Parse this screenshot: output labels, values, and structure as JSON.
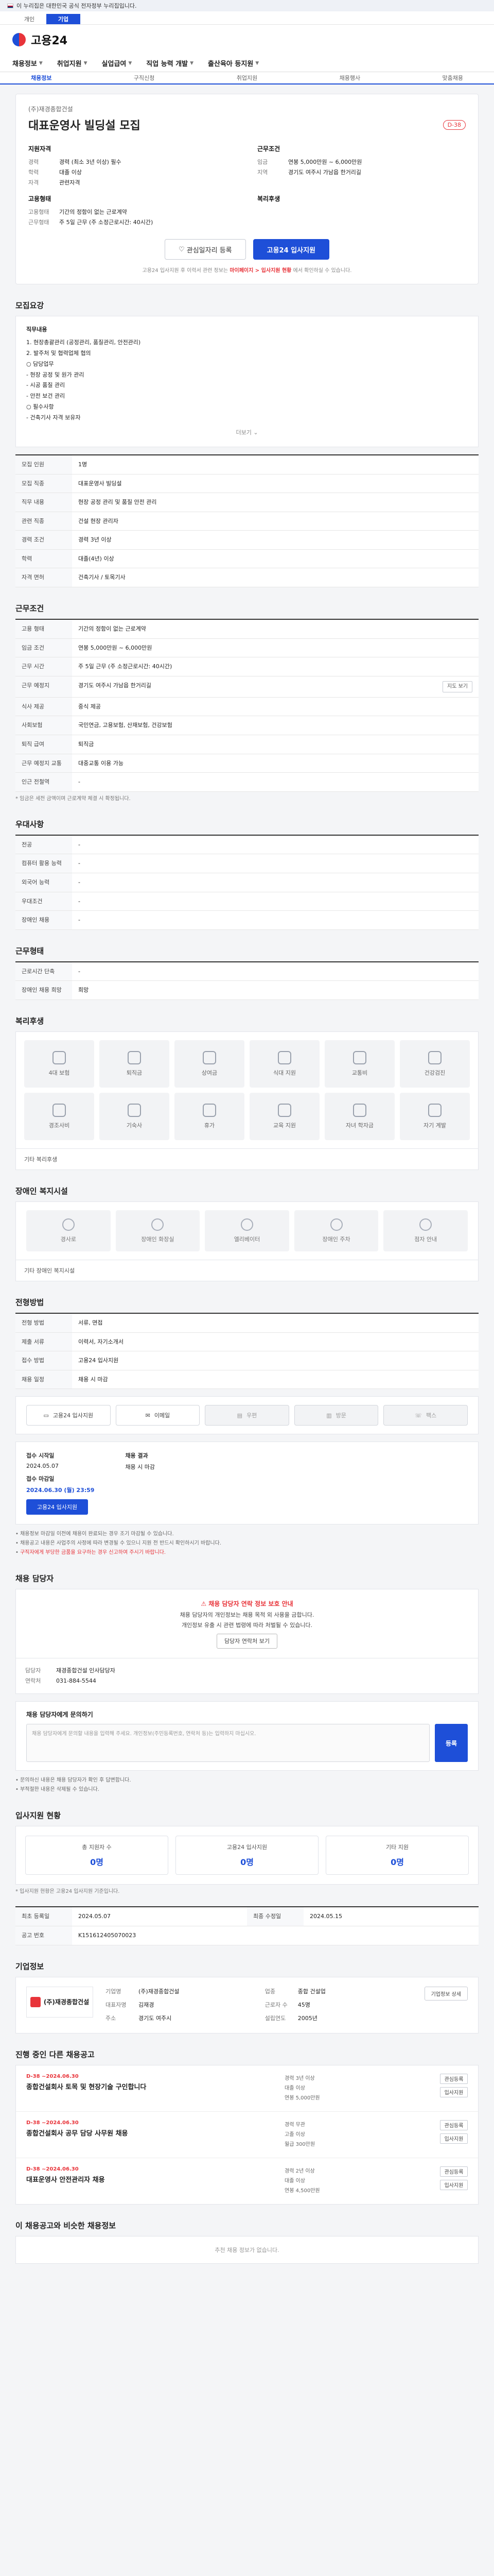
{
  "gov_banner": "이 누리집은 대한민국 공식 전자정부 누리집입니다.",
  "top_tabs": [
    "개인",
    "기업"
  ],
  "logo": "고용24",
  "gnb": [
    "채용정보",
    "취업지원",
    "실업급여",
    "직업 능력 개발",
    "출산육아 등지원"
  ],
  "subnav": [
    "채용정보",
    "구직신청",
    "취업지원",
    "채용행사",
    "맞춤채용"
  ],
  "job": {
    "company": "(주)재경종합건설",
    "title": "대표운영사 빌딩설 모집",
    "dday": "D-38",
    "qual_title": "지원자격",
    "qual": [
      {
        "k": "경력",
        "v": "경력 (최소 3년 이상) 필수"
      },
      {
        "k": "학력",
        "v": "대졸 이상"
      },
      {
        "k": "자격",
        "v": "관련자격"
      }
    ],
    "cond_title": "근무조건",
    "cond": [
      {
        "k": "임금",
        "v": "연봉 5,000만원 ~ 6,000만원"
      },
      {
        "k": "지역",
        "v": "경기도 여주시 가남읍 한거리길"
      }
    ],
    "form_title": "고용형태",
    "form": [
      {
        "k": "고용형태",
        "v": "기간의 정함이 없는 근로계약"
      },
      {
        "k": "근무형태",
        "v": "주 5일 근무 (주 소정근로시간: 40시간)"
      }
    ],
    "welfare_title": "복리후생",
    "btn_interest": "관심일자리 등록",
    "btn_apply": "고용24 입사지원",
    "notice_pre": "고용24 입사지원 후 이력서 관련 정보는",
    "notice_red": "마이페이지 > 입사지원 현황",
    "notice_post": "에서 확인하실 수 있습니다."
  },
  "sections": {
    "recruit": "모집요강",
    "duty_label": "직무내용",
    "duty_lines": [
      "1. 현장총괄관리 (공정관리, 품질관리, 안전관리)",
      "2. 발주처 및 협력업체 협의",
      "○ 담당업무",
      "- 현장 공정 및 원가 관리",
      "- 시공 품질 관리",
      "- 안전 보건 관리",
      "○ 필수사항",
      "- 건축기사 자격 보유자"
    ],
    "duty_more": "더보기",
    "work_cond": "근무조건",
    "employ_type": "근무형태",
    "prefer": "우대사항",
    "welfare": "복리후생",
    "disab": "장애인 복지시설",
    "apply_method": "전형방법",
    "contact": "채용 담당자",
    "stats": "입사지원 현황",
    "company": "기업정보",
    "others": "진행 중인 다른 채용공고"
  },
  "recruit_table": [
    {
      "k": "모집 인원",
      "v": "1명"
    },
    {
      "k": "모집 직종",
      "v": "대표운영사 빌딩설"
    },
    {
      "k": "직무 내용",
      "v": "현장 공정 관리 및 품질 안전 관리"
    },
    {
      "k": "관련 직종",
      "v": "건설 현장 관리자"
    },
    {
      "k": "경력 조건",
      "v": "경력 3년 이상"
    },
    {
      "k": "학력",
      "v": "대졸(4년) 이상"
    },
    {
      "k": "자격 면허",
      "v": "건축기사 / 토목기사"
    }
  ],
  "work_table": [
    {
      "k": "고용 형태",
      "v": "기간의 정함이 없는 근로계약"
    },
    {
      "k": "임금 조건",
      "v": "연봉 5,000만원 ~ 6,000만원"
    },
    {
      "k": "근무 시간",
      "v": "주 5일 근무 (주 소정근로시간: 40시간)"
    },
    {
      "k": "근무 예정지",
      "v": "경기도 여주시 가남읍 한거리길"
    },
    {
      "k": "식사 제공",
      "v": "중식 제공"
    },
    {
      "k": "사회보험",
      "v": "국민연금, 고용보험, 산재보험, 건강보험"
    },
    {
      "k": "퇴직 급여",
      "v": "퇴직금"
    },
    {
      "k": "근무 예정지 교통",
      "v": "대중교통 이용 가능"
    },
    {
      "k": "인근 전철역",
      "v": "-"
    }
  ],
  "pay_note": "* 임금은 세전 금액이며 근로계약 체결 시 확정됩니다.",
  "prefer_table": [
    {
      "k": "전공",
      "v": "-"
    },
    {
      "k": "컴퓨터 활용 능력",
      "v": "-"
    },
    {
      "k": "외국어 능력",
      "v": "-"
    },
    {
      "k": "우대조건",
      "v": "-"
    },
    {
      "k": "장애인 채용",
      "v": "-"
    }
  ],
  "etc_table": [
    {
      "k": "근로시간 단축",
      "v": "-"
    },
    {
      "k": "장애인 채용 희망",
      "v": "희망"
    }
  ],
  "welfare_items": [
    "4대 보험",
    "퇴직금",
    "상여금",
    "식대 지원",
    "교통비",
    "건강검진",
    "경조사비",
    "기숙사",
    "휴가",
    "교육 지원",
    "자녀 학자금",
    "자기 계발"
  ],
  "welfare_etc": "기타 복리후생",
  "disab_items": [
    "경사로",
    "장애인 화장실",
    "엘리베이터",
    "장애인 주차",
    "점자 안내"
  ],
  "disab_etc": "기타 장애인 복지시설",
  "apply_table": [
    {
      "k": "전형 방법",
      "v": "서류, 면접"
    },
    {
      "k": "제출 서류",
      "v": "이력서, 자기소개서"
    },
    {
      "k": "접수 방법",
      "v": "고용24 입사지원"
    },
    {
      "k": "채용 일정",
      "v": "채용 시 마감"
    }
  ],
  "apply_methods": [
    {
      "label": "고용24 입사지원",
      "on": true
    },
    {
      "label": "이메일",
      "on": true
    },
    {
      "label": "우편",
      "on": false
    },
    {
      "label": "방문",
      "on": false
    },
    {
      "label": "팩스",
      "on": false
    }
  ],
  "deadline": {
    "start_label": "접수 시작일",
    "start": "2024.05.07",
    "end_label": "접수 마감일",
    "end": "2024.06.30 (월) 23:59",
    "apply_btn": "고용24 입사지원",
    "result_label": "채용 결과",
    "result": "채용 시 마감"
  },
  "deadline_bullets": [
    "채용정보 마감일 이전에 채용이 완료되는 경우 조기 마감될 수 있습니다.",
    "채용공고 내용은 사업주의 사정에 따라 변경될 수 있으니 지원 전 반드시 확인하시기 바랍니다.",
    "구직자에게 부당한 금품을 요구하는 경우 신고하여 주시기 바랍니다."
  ],
  "contact_warn": {
    "title": "채용 담당자 연락 정보 보호 안내",
    "l1": "채용 담당자의 개인정보는 채용 목적 외 사용을 금합니다.",
    "l2": "개인정보 유출 시 관련 법령에 따라 처벌될 수 있습니다.",
    "btn": "담당자 연락처 보기"
  },
  "contact_card": {
    "name_k": "담당자",
    "name_v": "재경종합건설 인사담당자",
    "tel_k": "연락처",
    "tel_v": "031-884-5544"
  },
  "inquiry": {
    "label": "채용 담당자에게 문의하기",
    "placeholder": "채용 담당자에게 문의할 내용을 입력해 주세요. 개인정보(주민등록번호, 연락처 등)는 입력하지 마십시오.",
    "btn": "등록"
  },
  "inquiry_notes": [
    "문의하신 내용은 채용 담당자가 확인 후 답변합니다.",
    "부적절한 내용은 삭제될 수 있습니다."
  ],
  "stats": [
    {
      "label": "총 지원자 수",
      "num": "0명"
    },
    {
      "label": "고용24 입사지원",
      "num": "0명"
    },
    {
      "label": "기타 지원",
      "num": "0명"
    }
  ],
  "stats_note": "* 입사지원 현황은 고용24 입사지원 기준입니다.",
  "reg_table": [
    {
      "k": "최초 등록일",
      "v": "2024.05.07"
    },
    {
      "k": "최종 수정일",
      "v": "2024.05.15"
    },
    {
      "k": "공고 번호",
      "v": "K151612405070023"
    }
  ],
  "company": {
    "logo": "(주)재경종합건설",
    "info": [
      {
        "k": "기업명",
        "v": "(주)재경종합건설"
      },
      {
        "k": "업종",
        "v": "종합 건설업"
      },
      {
        "k": "대표자명",
        "v": "김재경"
      },
      {
        "k": "근로자 수",
        "v": "45명"
      },
      {
        "k": "주소",
        "v": "경기도 여주시"
      },
      {
        "k": "설립연도",
        "v": "2005년"
      }
    ],
    "btn": "기업정보 상세"
  },
  "other_jobs": [
    {
      "dday": "D-38 ~2024.06.30",
      "title": "종합건설회사 토목 및 현장기술 구인합니다",
      "meta": [
        "경력 3년 이상",
        "대졸 이상",
        "연봉 5,000만원"
      ],
      "btn1": "관심등록",
      "btn2": "입사지원"
    },
    {
      "dday": "D-38 ~2024.06.30",
      "title": "종합건설회사 공무 담당 사무원 채용",
      "meta": [
        "경력 무관",
        "고졸 이상",
        "월급 300만원"
      ],
      "btn1": "관심등록",
      "btn2": "입사지원"
    },
    {
      "dday": "D-38 ~2024.06.30",
      "title": "대표운영사 안전관리자 채용",
      "meta": [
        "경력 2년 이상",
        "대졸 이상",
        "연봉 4,500만원"
      ],
      "btn1": "관심등록",
      "btn2": "입사지원"
    }
  ],
  "recommend_title": "이 채용공고와 비슷한 채용정보",
  "recommend_empty": "추천 채용 정보가 없습니다."
}
